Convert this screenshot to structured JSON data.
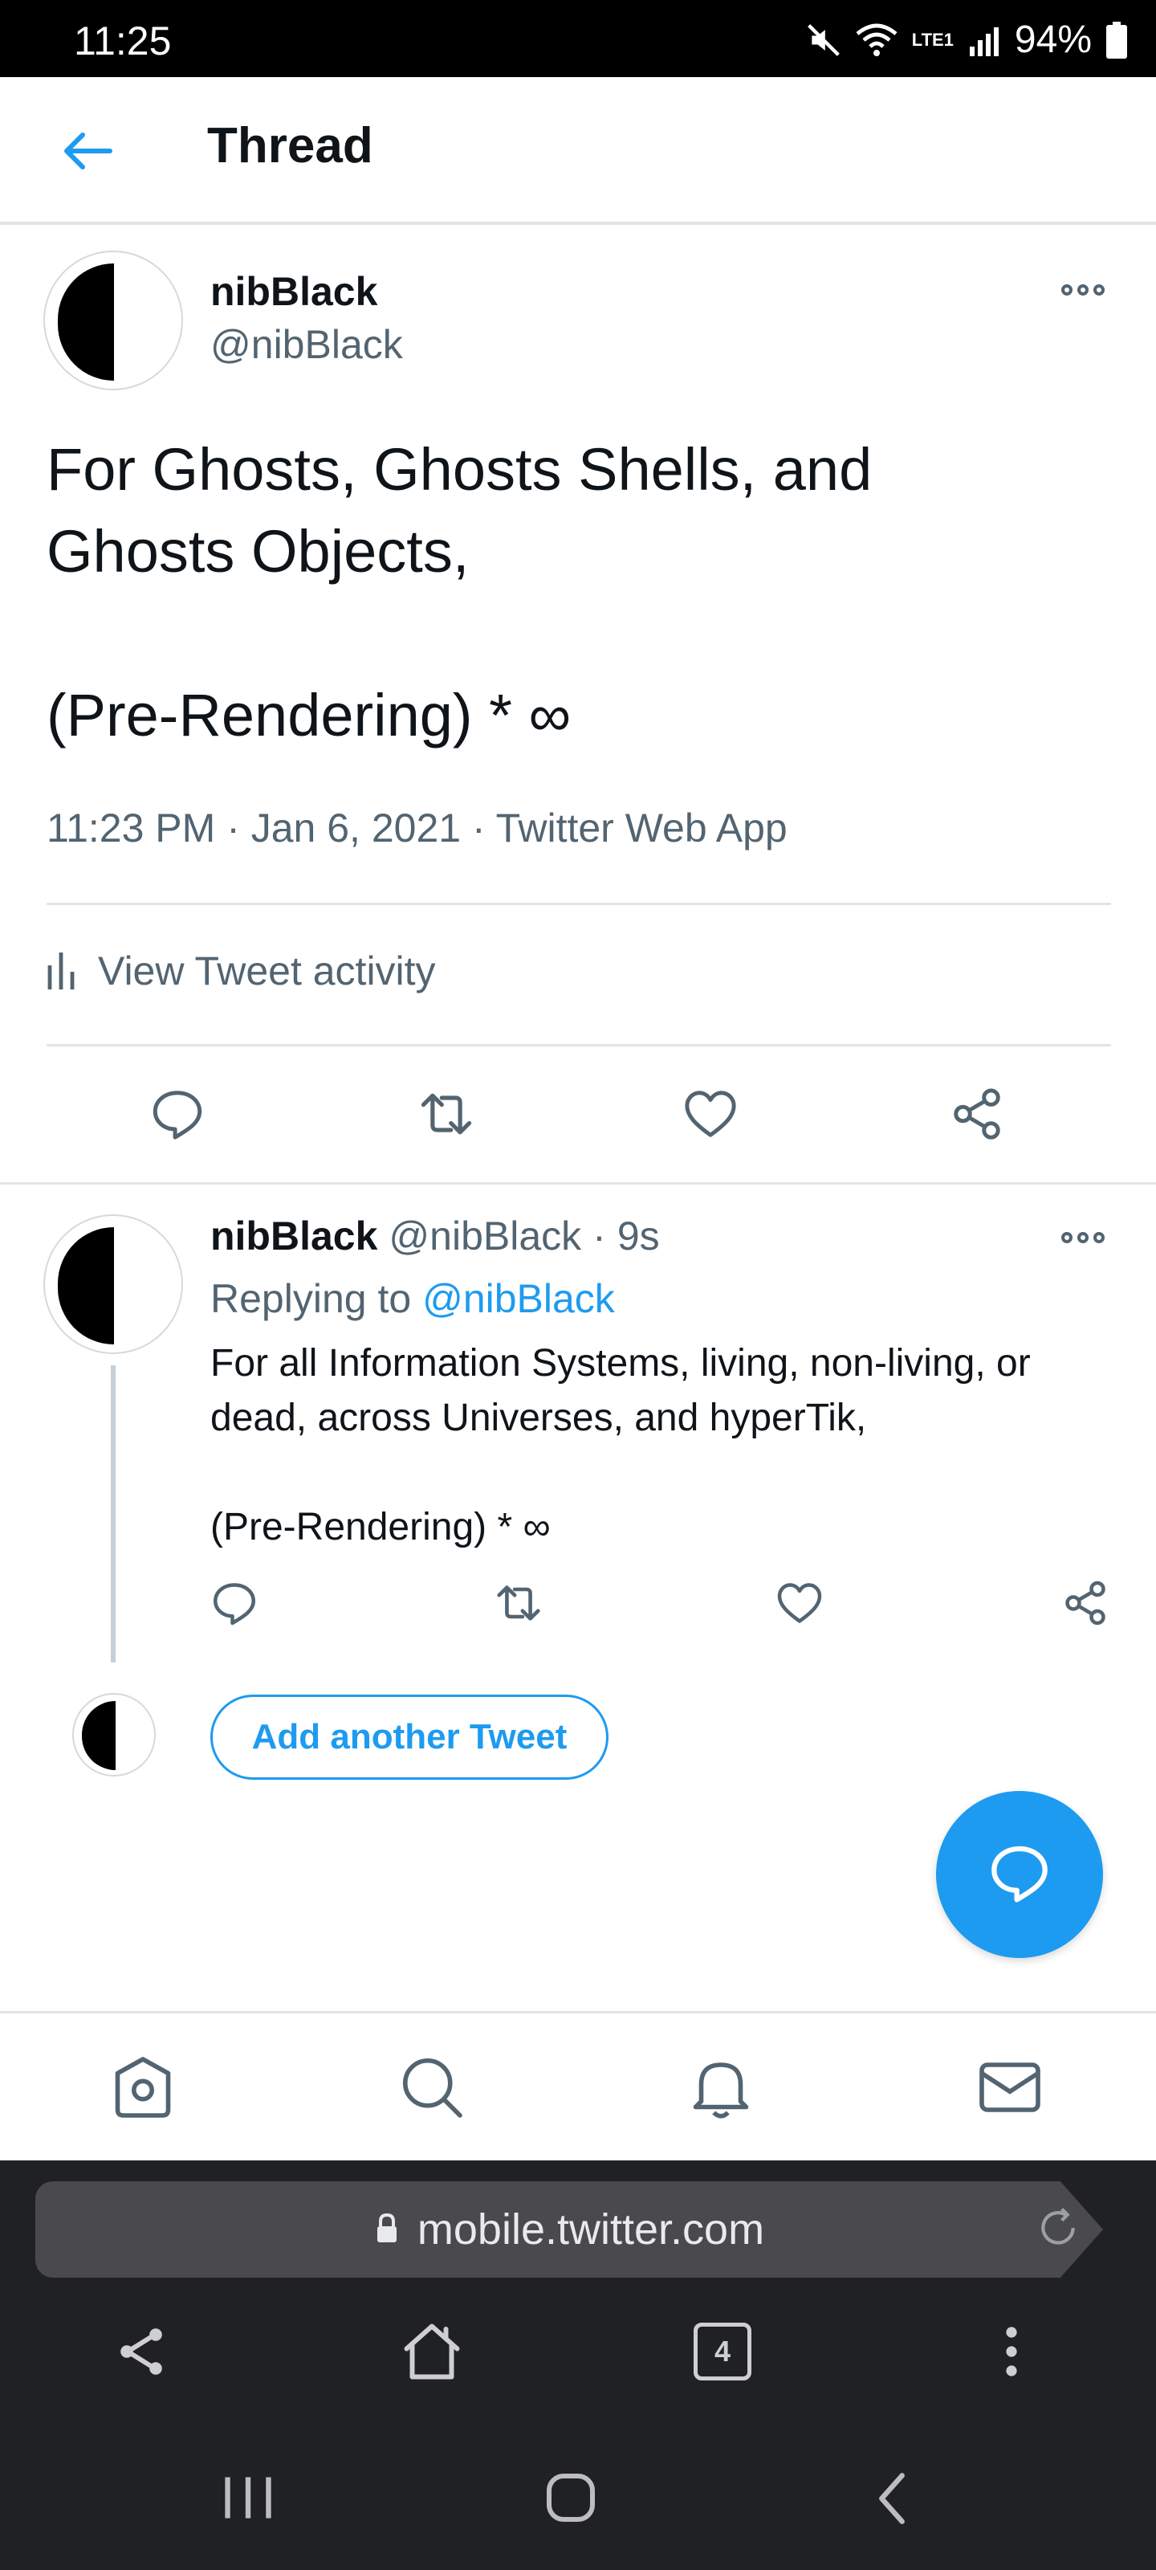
{
  "status_bar": {
    "time": "11:25",
    "network_label": "LTE1",
    "battery": "94%",
    "icons": [
      "mute-icon",
      "wifi-icon",
      "signal-icon",
      "battery-icon"
    ]
  },
  "header": {
    "title": "Thread",
    "back_icon": "arrow-left-icon"
  },
  "main_tweet": {
    "name": "nibBlack",
    "handle": "@nibBlack",
    "text": "For Ghosts, Ghosts Shells, and\nGhosts Objects,\n\n(Pre-Rendering) * ∞",
    "meta": "11:23 PM · Jan 6, 2021 · Twitter Web App",
    "activity_label": "View Tweet activity",
    "actions": [
      "reply-icon",
      "retweet-icon",
      "like-icon",
      "share-icon"
    ]
  },
  "reply_tweet": {
    "name": "nibBlack",
    "handle": "@nibBlack",
    "time_sep": "·",
    "time": "9s",
    "replying_prefix": "Replying to",
    "replying_handle": "@nibBlack",
    "text": "For all Information Systems, living, non-living, or\ndead, across Universes, and hyperTik,\n\n(Pre-Rendering) * ∞",
    "actions": [
      "reply-icon",
      "retweet-icon",
      "like-icon",
      "share-icon"
    ]
  },
  "compose": {
    "add_tweet_label": "Add another Tweet"
  },
  "bottom_nav": [
    "home-icon",
    "search-icon",
    "notifications-icon",
    "messages-icon"
  ],
  "browser": {
    "url": "mobile.twitter.com",
    "tab_count": "4"
  },
  "colors": {
    "accent": "#1d9bf0",
    "text": "#0f1419",
    "secondary": "#536471",
    "divider": "#e1e4e8"
  }
}
